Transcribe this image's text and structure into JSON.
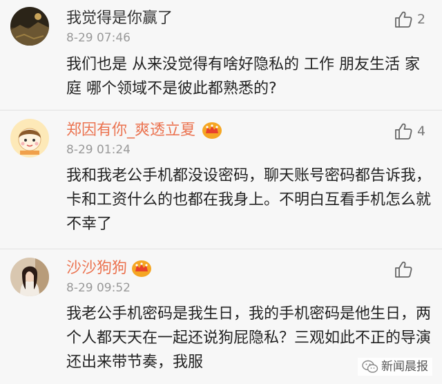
{
  "comments": [
    {
      "username": "我觉得是你赢了",
      "timestamp": "8-29 07:46",
      "likes": "2",
      "text": "我们也是 从来没觉得有啥好隐私的 工作  朋友生活 家庭 哪个领域不是彼此都熟悉的?",
      "avatar_icon": "dark-landscape-avatar",
      "vip": false
    },
    {
      "username": "郑因有你_爽透立夏",
      "timestamp": "8-29 01:24",
      "likes": "4",
      "text": "我和我老公手机都没设密码，聊天账号密码都告诉我，卡和工资什么的也都在我身上。不明白互看手机怎么就不幸了",
      "avatar_icon": "cartoon-girl-avatar",
      "vip": true
    },
    {
      "username": "沙沙狗狗",
      "timestamp": "8-29 09:52",
      "likes": "",
      "text": "我老公手机密码是我生日，我的手机密码是他生日，两个人都天天在一起还说狗屁隐私？三观如此不正的导演还出来带节奏，我服",
      "avatar_icon": "photo-portrait-avatar",
      "vip": true
    }
  ],
  "watermark": {
    "text": "新闻晨报",
    "icon": "wechat-icon"
  },
  "colors": {
    "background": "#f7f7f7",
    "vip_name": "#eb7350",
    "timestamp": "#999999",
    "crown": "#f5a623"
  }
}
